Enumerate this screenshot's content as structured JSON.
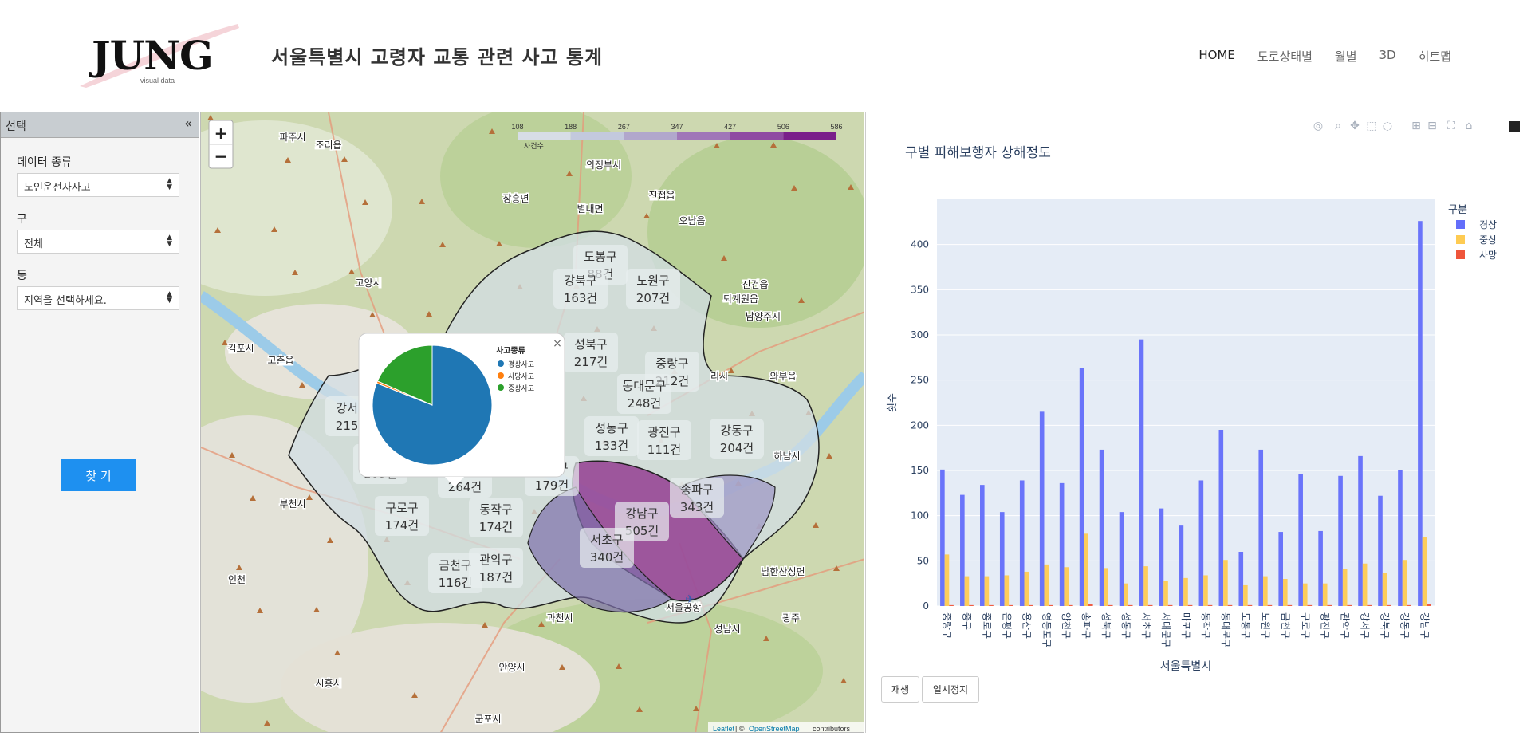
{
  "header": {
    "logo_text": "JUNG",
    "logo_tagline": "visual data",
    "title": "서울특별시 고령자 교통 관련 사고 통계",
    "nav": [
      {
        "label": "HOME"
      },
      {
        "label": "도로상태별"
      },
      {
        "label": "월별"
      },
      {
        "label": "3D"
      },
      {
        "label": "히트맵"
      }
    ]
  },
  "sidebar": {
    "title": "선택",
    "collapse_glyph": "«",
    "fields": [
      {
        "label": "데이터 종류",
        "value": "노인운전자사고"
      },
      {
        "label": "구",
        "value": "전체"
      },
      {
        "label": "동",
        "value": "지역을 선택하세요."
      }
    ],
    "find_button": "찾 기"
  },
  "map": {
    "zoom_in": "+",
    "zoom_out": "−",
    "colorbar": {
      "ticks": [
        "108",
        "188",
        "267",
        "347",
        "427",
        "506",
        "586"
      ],
      "label": "사건수"
    },
    "places": [
      "파주시",
      "조리읍",
      "의정부시",
      "장흥면",
      "별내면",
      "진접읍",
      "오남읍",
      "고양시",
      "퇴계원읍",
      "진건읍",
      "남양주시",
      "김포시",
      "고촌읍",
      "리시",
      "와부읍",
      "하남시",
      "부천시",
      "인천",
      "과천시",
      "성남시",
      "광주",
      "안양시",
      "시흥시",
      "군포시",
      "남한산성면",
      "서울공항"
    ],
    "districts": [
      {
        "name": "도봉구",
        "count": "88건"
      },
      {
        "name": "강북구",
        "count": "163건"
      },
      {
        "name": "노원구",
        "count": "207건"
      },
      {
        "name": "성북구",
        "count": "217건"
      },
      {
        "name": "중랑구",
        "count": "212건"
      },
      {
        "name": "동대문구",
        "count": "248건"
      },
      {
        "name": "강서구",
        "count": "215건"
      },
      {
        "name": "성동구",
        "count": "133건"
      },
      {
        "name": "광진구",
        "count": "111건"
      },
      {
        "name": "강동구",
        "count": "204건"
      },
      {
        "name": "양천구",
        "count": "183건"
      },
      {
        "name": "영등포구",
        "count": "264건"
      },
      {
        "name": "용산구",
        "count": "179건"
      },
      {
        "name": "구로구",
        "count": "174건"
      },
      {
        "name": "동작구",
        "count": "174건"
      },
      {
        "name": "강남구",
        "count": "505건"
      },
      {
        "name": "송파구",
        "count": "343건"
      },
      {
        "name": "서초구",
        "count": "340건"
      },
      {
        "name": "금천구",
        "count": "116건"
      },
      {
        "name": "관악구",
        "count": "187건"
      }
    ],
    "popup": {
      "close": "×",
      "legend_title": "사고종류",
      "slices": [
        {
          "name": "경상사고",
          "value": 81.0,
          "color": "#1f77b4"
        },
        {
          "name": "사망사고",
          "value": 0.6,
          "color": "#ff7f0e"
        },
        {
          "name": "중상사고",
          "value": 18.4,
          "color": "#2ca02c"
        }
      ]
    },
    "attribution": {
      "leaflet": "Leaflet",
      "rest": " | © ",
      "osm": "OpenStreetMap",
      "tail": " contributors"
    }
  },
  "chart_data": {
    "type": "bar",
    "title": "구별 피해보행자 상해정도",
    "xlabel": "서울특별시",
    "ylabel": "횟수",
    "ylim": [
      0,
      450
    ],
    "yticks": [
      0,
      50,
      100,
      150,
      200,
      250,
      300,
      350,
      400
    ],
    "legend_title": "구분",
    "legend_position": "top-right",
    "categories": [
      "중랑구",
      "중구",
      "종로구",
      "은평구",
      "용산구",
      "영등포구",
      "양천구",
      "송파구",
      "성북구",
      "성동구",
      "서초구",
      "서대문구",
      "마포구",
      "동작구",
      "동대문구",
      "도봉구",
      "노원구",
      "금천구",
      "구로구",
      "광진구",
      "관악구",
      "강서구",
      "강북구",
      "강동구",
      "강남구"
    ],
    "series": [
      {
        "name": "경상",
        "color": "#636efa",
        "values": [
          151,
          123,
          134,
          104,
          139,
          215,
          136,
          263,
          173,
          104,
          295,
          108,
          89,
          139,
          195,
          60,
          173,
          82,
          146,
          83,
          144,
          166,
          122,
          150,
          426
        ]
      },
      {
        "name": "중상",
        "color": "#fecb52",
        "values": [
          57,
          33,
          33,
          34,
          38,
          46,
          43,
          80,
          42,
          25,
          44,
          28,
          31,
          34,
          51,
          23,
          33,
          30,
          25,
          25,
          41,
          47,
          37,
          51,
          76
        ]
      },
      {
        "name": "사망",
        "color": "#ef553b",
        "values": [
          1,
          1,
          1,
          1,
          1,
          1,
          1,
          2,
          1,
          1,
          1,
          1,
          1,
          1,
          1,
          1,
          1,
          1,
          1,
          1,
          1,
          1,
          1,
          1,
          2
        ]
      }
    ]
  },
  "controls": {
    "play": "재생",
    "pause": "일시정지"
  }
}
